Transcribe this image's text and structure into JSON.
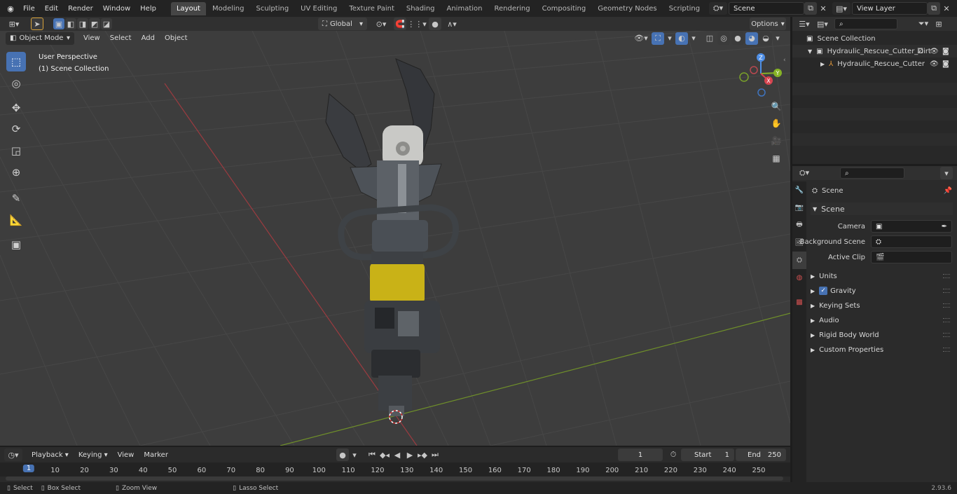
{
  "topbar": {
    "menus": [
      "File",
      "Edit",
      "Render",
      "Window",
      "Help"
    ],
    "workspaces": [
      "Layout",
      "Modeling",
      "Sculpting",
      "UV Editing",
      "Texture Paint",
      "Shading",
      "Animation",
      "Rendering",
      "Compositing",
      "Geometry Nodes",
      "Scripting"
    ],
    "active_workspace": "Layout",
    "scene_name": "Scene",
    "view_layer": "View Layer"
  },
  "tool_header": {
    "orientation": "Global",
    "options_label": "Options"
  },
  "viewport_header": {
    "mode": "Object Mode",
    "menus": [
      "View",
      "Select",
      "Add",
      "Object"
    ]
  },
  "viewport": {
    "perspective_label": "User Perspective",
    "collection_label": "(1) Scene Collection",
    "gizmo_axes": {
      "x": "X",
      "y": "Y",
      "z": "Z"
    },
    "colors": {
      "background": "#3d3d3d",
      "grid": "#4a4a4a",
      "x_axis": "#d64550",
      "y_axis": "#86b326",
      "yellow_band": "#c9b217"
    }
  },
  "outliner": {
    "root": "Scene Collection",
    "items": [
      {
        "name": "Hydraulic_Rescue_Cutter_Dirt",
        "level": 1,
        "expanded": true
      },
      {
        "name": "Hydraulic_Rescue_Cutter",
        "level": 2,
        "expanded": false
      }
    ]
  },
  "properties": {
    "context": "Scene",
    "section": "Scene",
    "fields": [
      {
        "label": "Camera",
        "value": ""
      },
      {
        "label": "Background Scene",
        "value": ""
      },
      {
        "label": "Active Clip",
        "value": ""
      }
    ],
    "panels": [
      "Units",
      "Gravity",
      "Keying Sets",
      "Audio",
      "Rigid Body World",
      "Custom Properties"
    ],
    "gravity_checked": true
  },
  "timeline": {
    "menus": [
      "Playback",
      "Keying",
      "View",
      "Marker"
    ],
    "current_frame": "1",
    "start_label": "Start",
    "start": "1",
    "end_label": "End",
    "end": "250",
    "ruler": [
      "1",
      "10",
      "20",
      "30",
      "40",
      "50",
      "60",
      "70",
      "80",
      "90",
      "100",
      "110",
      "120",
      "130",
      "140",
      "150",
      "160",
      "170",
      "180",
      "190",
      "200",
      "210",
      "220",
      "230",
      "240",
      "250"
    ]
  },
  "statusbar": {
    "select": "Select",
    "box_select": "Box Select",
    "zoom_view": "Zoom View",
    "lasso_select": "Lasso Select",
    "version": "2.93.6"
  }
}
